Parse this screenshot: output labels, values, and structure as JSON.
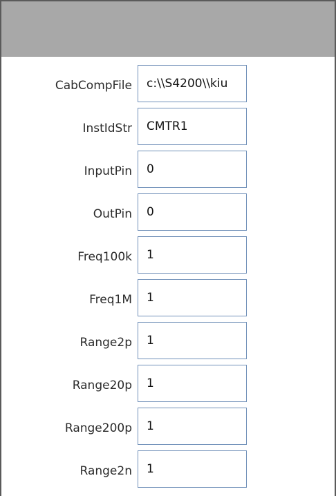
{
  "form": {
    "fields": [
      {
        "label": "CabCompFile",
        "value": "c:\\\\S4200\\\\kiu"
      },
      {
        "label": "InstIdStr",
        "value": "CMTR1"
      },
      {
        "label": "InputPin",
        "value": "0"
      },
      {
        "label": "OutPin",
        "value": "0"
      },
      {
        "label": "Freq100k",
        "value": "1"
      },
      {
        "label": "Freq1M",
        "value": "1"
      },
      {
        "label": "Range2p",
        "value": "1"
      },
      {
        "label": "Range20p",
        "value": "1"
      },
      {
        "label": "Range200p",
        "value": "1"
      },
      {
        "label": "Range2n",
        "value": "1"
      }
    ]
  }
}
